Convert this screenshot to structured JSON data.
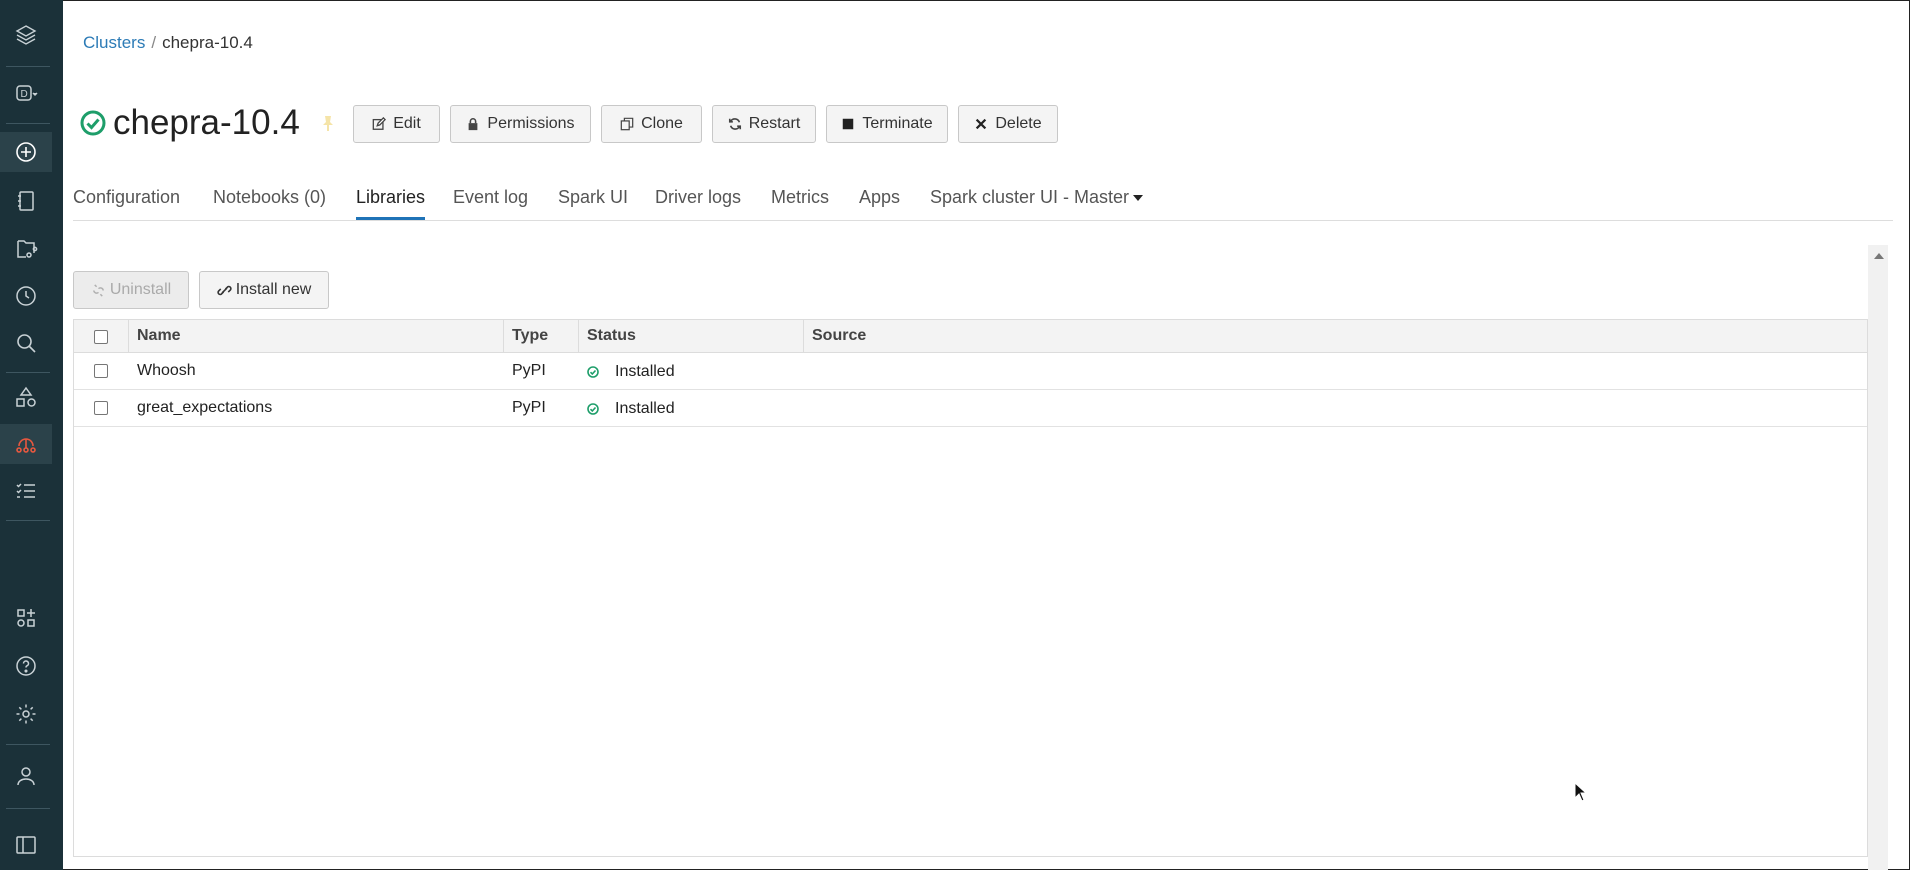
{
  "sidebar": {
    "items": [
      {
        "icon": "layers-logo-icon"
      },
      {
        "icon": "workspace-switcher-icon"
      },
      {
        "icon": "create-plus-icon"
      },
      {
        "icon": "notebook-icon"
      },
      {
        "icon": "repos-icon"
      },
      {
        "icon": "recents-clock-icon"
      },
      {
        "icon": "search-icon"
      },
      {
        "icon": "data-shapes-icon"
      },
      {
        "icon": "compute-icon"
      },
      {
        "icon": "jobs-icon"
      },
      {
        "icon": "partner-connect-icon"
      },
      {
        "icon": "help-icon"
      },
      {
        "icon": "settings-icon"
      },
      {
        "icon": "user-icon"
      },
      {
        "icon": "sidebar-toggle-icon"
      }
    ],
    "active_index": 8,
    "active_color": "#e8583f"
  },
  "breadcrumb": {
    "parent": "Clusters",
    "separator": "/",
    "current": "chepra-10.4"
  },
  "cluster": {
    "name": "chepra-10.4",
    "status": "running"
  },
  "toolbar": {
    "edit": "Edit",
    "permissions": "Permissions",
    "clone": "Clone",
    "restart": "Restart",
    "terminate": "Terminate",
    "delete": "Delete"
  },
  "tabs": [
    {
      "label": "Configuration"
    },
    {
      "label": "Notebooks (0)"
    },
    {
      "label": "Libraries"
    },
    {
      "label": "Event log"
    },
    {
      "label": "Spark UI"
    },
    {
      "label": "Driver logs"
    },
    {
      "label": "Metrics"
    },
    {
      "label": "Apps"
    },
    {
      "label": "Spark cluster UI - Master"
    }
  ],
  "active_tab": "Libraries",
  "library_actions": {
    "uninstall": "Uninstall",
    "install_new": "Install new"
  },
  "library_table": {
    "columns": [
      "Name",
      "Type",
      "Status",
      "Source"
    ],
    "rows": [
      {
        "name": "Whoosh",
        "type": "PyPI",
        "status": "Installed",
        "source": ""
      },
      {
        "name": "great_expectations",
        "type": "PyPI",
        "status": "Installed",
        "source": ""
      }
    ]
  },
  "colors": {
    "sidebar_bg": "#1b3139",
    "accent": "#1f73b7",
    "status_ok": "#1e9e6a"
  }
}
